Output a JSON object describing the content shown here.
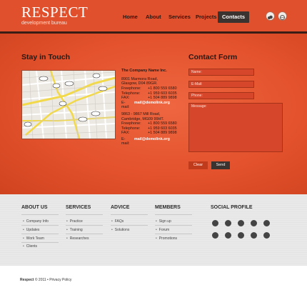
{
  "header": {
    "logo": "RESPECT",
    "tagline": "development bureau",
    "nav": [
      "Home",
      "About",
      "Services",
      "Projects",
      "Contacts"
    ],
    "active_nav": "Contacts",
    "social_icons": [
      "cloud-icon",
      "globe-icon"
    ]
  },
  "stay_in_touch": {
    "title": "Stay in Touch",
    "map_icon": "city-map",
    "company": "The Company Name Inc.",
    "address1": {
      "street": "8901 Marmora Road,",
      "city": "Glasgow, D04 89GR.",
      "rows": [
        {
          "label": "Freephone:",
          "value": "+1 800 559 6580"
        },
        {
          "label": "Telephone:",
          "value": "+1 959 603 6035"
        },
        {
          "label": "FAX:",
          "value": "+1 504 889 9898"
        }
      ],
      "email_label": "E-mail:",
      "email": "mail@demolink.org"
    },
    "address2": {
      "street": "9863 - 9867 Mill Road,",
      "city": "Cambridge, MG09 99HT.",
      "rows": [
        {
          "label": "Freephone:",
          "value": "+1 800 559 6580"
        },
        {
          "label": "Telephone:",
          "value": "+1 959 603 6035"
        },
        {
          "label": "FAX:",
          "value": "+1 504 889 9898"
        }
      ],
      "email_label": "E-mail:",
      "email": "mail@demolink.org"
    }
  },
  "contact_form": {
    "title": "Contact Form",
    "name_placeholder": "Name:",
    "email_placeholder": "E-Mail:",
    "phone_placeholder": "Phone:",
    "message_placeholder": "Message:",
    "clear_label": "Clear",
    "send_label": "Send"
  },
  "footer": {
    "about": {
      "title": "ABOUT US",
      "items": [
        "Company Info",
        "Updates",
        "Work Team",
        "Clients"
      ]
    },
    "services": {
      "title": "SERVICES",
      "items": [
        "Practice",
        "Training",
        "Researches"
      ]
    },
    "advice": {
      "title": "ADVICE",
      "items": [
        "FAQs",
        "Solutions"
      ]
    },
    "members": {
      "title": "MEMBERS",
      "items": [
        "Sign up",
        "Forum",
        "Promotions"
      ]
    },
    "social": {
      "title": "SOCIAL PROFILE",
      "icons": [
        "delicious-icon",
        "facebook-icon",
        "flickr-icon",
        "dribbble-icon",
        "rss-icon",
        "digg-icon",
        "technorati-icon",
        "stumbleupon-icon",
        "skype-icon",
        "twitter-icon"
      ]
    }
  },
  "copyright": {
    "brand": "Respect",
    "text": "© 2011 • Privacy Policy"
  },
  "colors": {
    "accent": "#e0502d",
    "dark": "#3b3330",
    "footer_bg": "#e9e9e9"
  }
}
